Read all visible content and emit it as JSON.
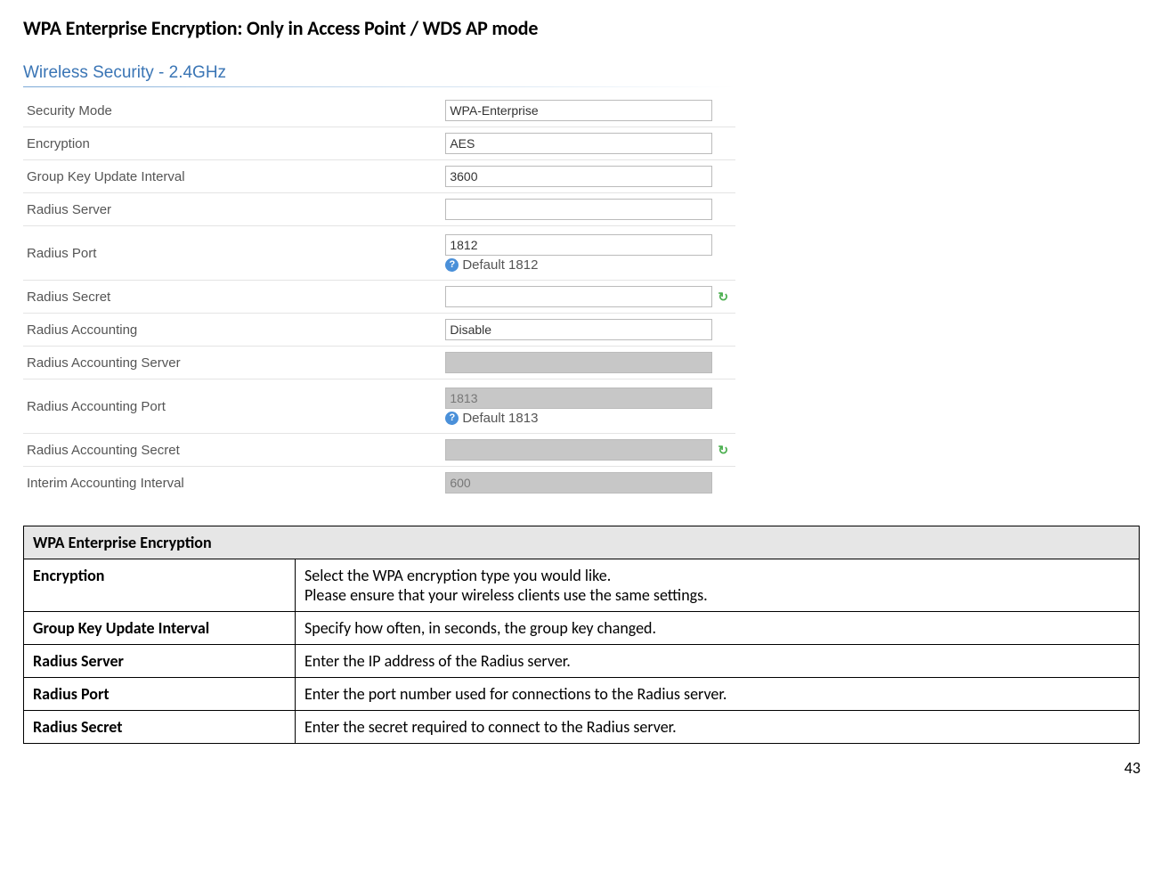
{
  "heading": "WPA Enterprise Encryption: Only in Access Point / WDS AP mode",
  "panel": {
    "title": "Wireless Security - 2.4GHz",
    "rows": {
      "security_mode": {
        "label": "Security Mode",
        "value": "WPA-Enterprise"
      },
      "encryption": {
        "label": "Encryption",
        "value": "AES"
      },
      "group_key": {
        "label": "Group Key Update Interval",
        "value": "3600"
      },
      "radius_server": {
        "label": "Radius Server",
        "value": ""
      },
      "radius_port": {
        "label": "Radius Port",
        "value": "1812",
        "hint": "Default 1812"
      },
      "radius_secret": {
        "label": "Radius Secret",
        "value": ""
      },
      "radius_acct": {
        "label": "Radius Accounting",
        "value": "Disable"
      },
      "acct_server": {
        "label": "Radius Accounting Server",
        "value": ""
      },
      "acct_port": {
        "label": "Radius Accounting Port",
        "value": "1813",
        "hint": "Default 1813"
      },
      "acct_secret": {
        "label": "Radius Accounting Secret",
        "value": ""
      },
      "interim": {
        "label": "Interim Accounting Interval",
        "value": "600"
      }
    }
  },
  "icons": {
    "help": "?",
    "refresh": "↻"
  },
  "def_table": {
    "header": "WPA Enterprise Encryption",
    "rows": [
      {
        "label": "Encryption",
        "desc1": "Select the WPA encryption type you would like.",
        "desc2": "Please ensure that your wireless clients use the same settings."
      },
      {
        "label": "Group Key Update Interval",
        "desc1": "Specify how often, in seconds, the group key changed."
      },
      {
        "label": "Radius Server",
        "desc1": "Enter the IP address of the Radius server."
      },
      {
        "label": "Radius Port",
        "desc1": "Enter the port number used for connections to the Radius server."
      },
      {
        "label": "Radius Secret",
        "desc1": "Enter the secret required to connect to the Radius server."
      }
    ]
  },
  "page_number": "43"
}
